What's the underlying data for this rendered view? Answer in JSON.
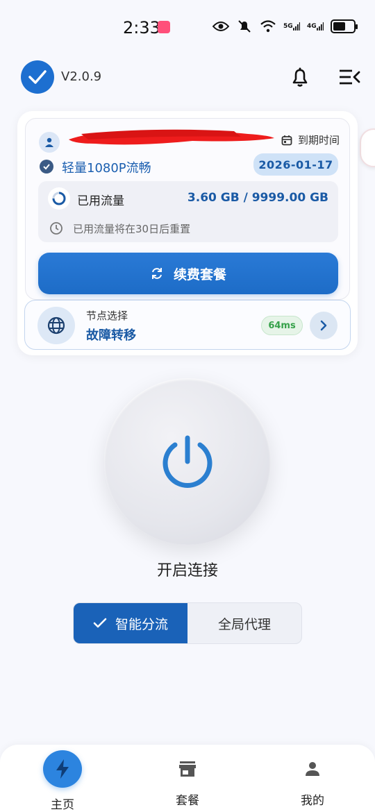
{
  "status_bar": {
    "time": "2:33",
    "icons": [
      "eye-icon",
      "mute-bell-icon",
      "wifi-icon",
      "signal-5g-icon",
      "signal-4g-icon",
      "battery-icon"
    ],
    "net_5g": "5G",
    "net_4g": "4G",
    "battery_level": 0.6
  },
  "header": {
    "version": "V2.0.9"
  },
  "account": {
    "expiry_label": "到期时间",
    "plan_name": "轻量1080P流畅",
    "expiry_date": "2026-01-17",
    "traffic_label": "已用流量",
    "traffic_value": "3.60 GB / 9999.00 GB",
    "reset_note": "已用流量将在30日后重置",
    "renew_label": "续费套餐"
  },
  "node": {
    "label": "节点选择",
    "name": "故障转移",
    "latency": "64ms"
  },
  "power": {
    "label": "开启连接"
  },
  "mode": {
    "smart": "智能分流",
    "global": "全局代理",
    "selected": "smart"
  },
  "nav": {
    "home": "主页",
    "plans": "套餐",
    "mine": "我的"
  },
  "colors": {
    "accent": "#1d6fd0",
    "accent_dark": "#1a62b8",
    "latency_green": "#36a14a",
    "background": "#f7f8fd"
  }
}
